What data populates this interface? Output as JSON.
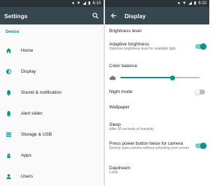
{
  "left": {
    "status_time": "6:10",
    "title": "Settings",
    "section_header": "Device",
    "items": [
      {
        "label": "Home"
      },
      {
        "label": "Display"
      },
      {
        "label": "Sound & notification"
      },
      {
        "label": "Alert slider"
      },
      {
        "label": "Storage & USB"
      },
      {
        "label": "Apps"
      },
      {
        "label": "Users"
      }
    ]
  },
  "right": {
    "status_time": "6:10",
    "title": "Display",
    "prefs": {
      "brightness_level": {
        "title": "Brightness level"
      },
      "adaptive_brightness": {
        "title": "Adaptive brightness",
        "summary": "Optimize brightness level for available light",
        "checked": true
      },
      "color_balance": {
        "title": "Color balance",
        "value": 0.66
      },
      "night_mode": {
        "title": "Night mode",
        "checked": false
      },
      "wallpaper": {
        "title": "Wallpaper"
      },
      "sleep": {
        "title": "Sleep",
        "summary": "After 30 seconds of inactivity"
      },
      "power_button_camera": {
        "title": "Press power button twice for camera",
        "summary": "Quickly open camera without unlocking your screen",
        "checked": true
      },
      "daydream": {
        "title": "Daydream",
        "summary": "Clock"
      }
    }
  },
  "colors": {
    "accent": "#009688",
    "appbar": "#37474f",
    "statusbar": "#2a3438"
  },
  "icons": [
    "search-icon",
    "back-arrow-icon",
    "home-icon",
    "display-brightness-icon",
    "bell-icon",
    "alert-slider-bell-icon",
    "storage-icon",
    "android-icon",
    "user-icon",
    "cloud-icon"
  ]
}
